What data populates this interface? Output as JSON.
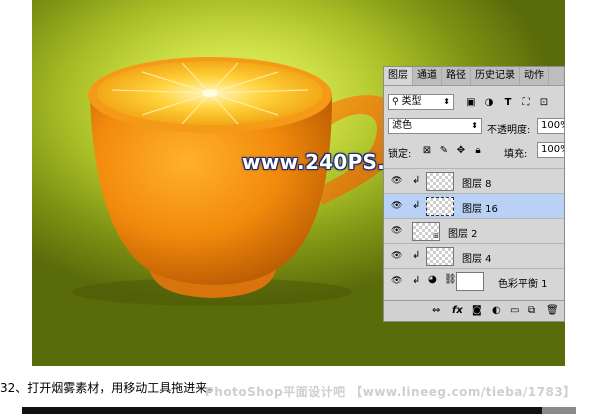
{
  "watermark": "www.240PS.com",
  "layers_panel": {
    "tabs": [
      "图层",
      "通道",
      "路径",
      "历史记录",
      "动作"
    ],
    "filter_kind": "类型",
    "blend_mode": "滤色",
    "opacity_label": "不透明度:",
    "opacity_value": "100%",
    "lock_label": "锁定:",
    "fill_label": "填充:",
    "fill_value": "100%",
    "layers": [
      {
        "name": "图层 8",
        "clipped": true,
        "selected": false
      },
      {
        "name": "图层 16",
        "clipped": true,
        "selected": true
      },
      {
        "name": "图层 2",
        "clipped": false,
        "selected": false
      },
      {
        "name": "图层 4",
        "clipped": true,
        "selected": false
      },
      {
        "name": "色彩平衡 1",
        "clipped": true,
        "selected": false
      }
    ]
  },
  "caption": "32、打开烟雾素材，用移动工具拖进来。",
  "caption_watermark": "PhotoShop平面设计吧 【www.lineeg.com/tieba/1783】",
  "colors": {
    "selected_layer": "#b9d1f4",
    "panel_bg": "#d6d6d6",
    "background_green": "#a9bf27"
  }
}
